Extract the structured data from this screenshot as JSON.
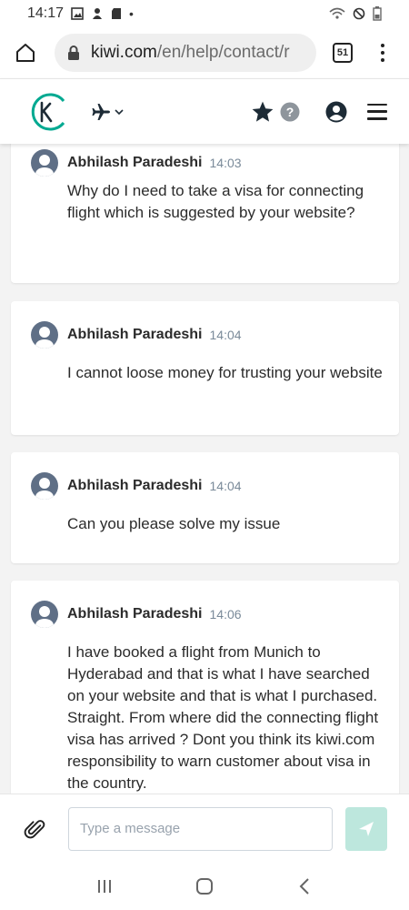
{
  "status_bar": {
    "time": "14:17"
  },
  "browser": {
    "url_host": "kiwi.com",
    "url_path": "/en/help/contact/r",
    "tab_count": "51"
  },
  "colors": {
    "brand_teal": "#00a991",
    "send_disabled": "#bde7dd",
    "avatar": "#5f6f86"
  },
  "messages": [
    {
      "sender": "Abhilash Paradeshi",
      "time": "14:03",
      "text": "Why do I need to take a visa for connecting flight which is suggested by your website?"
    },
    {
      "sender": "Abhilash Paradeshi",
      "time": "14:04",
      "text": "I cannot loose money for trusting your website"
    },
    {
      "sender": "Abhilash Paradeshi",
      "time": "14:04",
      "text": "Can you please solve my issue"
    },
    {
      "sender": "Abhilash Paradeshi",
      "time": "14:06",
      "text": "I have booked a flight from Munich to Hyderabad and that is what I have searched on your website and that is what I purchased. Straight. From where did the connecting flight visa has arrived ? Dont you think its kiwi.com responsibility to warn customer about visa in the country."
    }
  ],
  "composer": {
    "placeholder": "Type a message"
  }
}
